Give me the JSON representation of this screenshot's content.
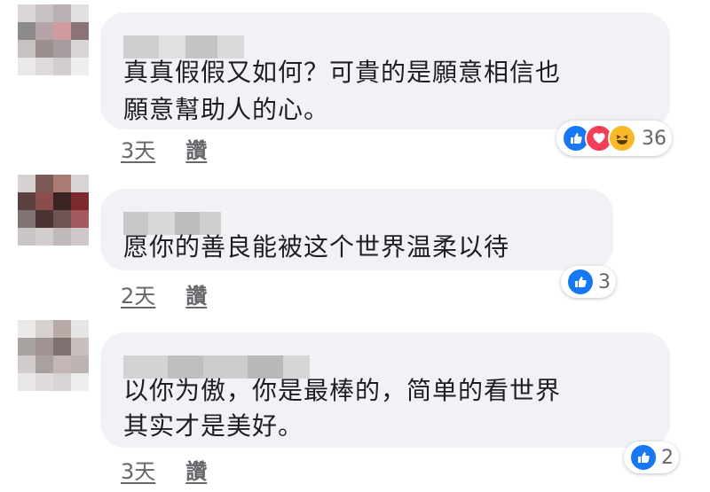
{
  "comments": [
    {
      "text_line1": "真真假假又如何？可貴的是願意相信也",
      "text_line2": "願意幫助人的心。",
      "time": "3天",
      "like_label": "讚",
      "reaction_count": "36",
      "reactions": [
        "like-icon",
        "love-icon",
        "haha-icon"
      ]
    },
    {
      "text_line1": "愿你的善良能被这个世界温柔以待",
      "time": "2天",
      "like_label": "讚",
      "reaction_count": "3",
      "reactions": [
        "like-icon"
      ]
    },
    {
      "text_line1": "以你为傲，你是最棒的，简单的看世界",
      "text_line2": "其实才是美好。",
      "time": "3天",
      "like_label": "讚",
      "reaction_count": "2",
      "reactions": [
        "like-icon"
      ]
    }
  ],
  "colors": {
    "bubble": "#f0f2f5",
    "like_blue": "#1877f2",
    "love_red": "#f33e58",
    "haha_yellow": "#f7b928",
    "meta_gray": "#65676b"
  }
}
